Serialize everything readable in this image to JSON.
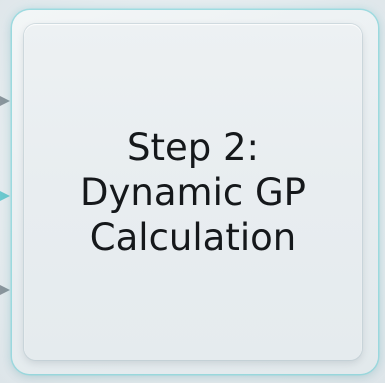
{
  "box": {
    "title_lines": [
      "Step 2:",
      "Dynamic GP",
      "Calculation"
    ]
  },
  "colors": {
    "glow": "#78d7dc",
    "text": "#15181b",
    "card": "#e8edf0",
    "connector_arrow": "#8a959c",
    "connector_arrow_accent": "#6cc9cf"
  },
  "icons": {
    "incoming_arrows": [
      "arrow-right-icon",
      "arrow-right-icon",
      "arrow-right-icon"
    ]
  }
}
